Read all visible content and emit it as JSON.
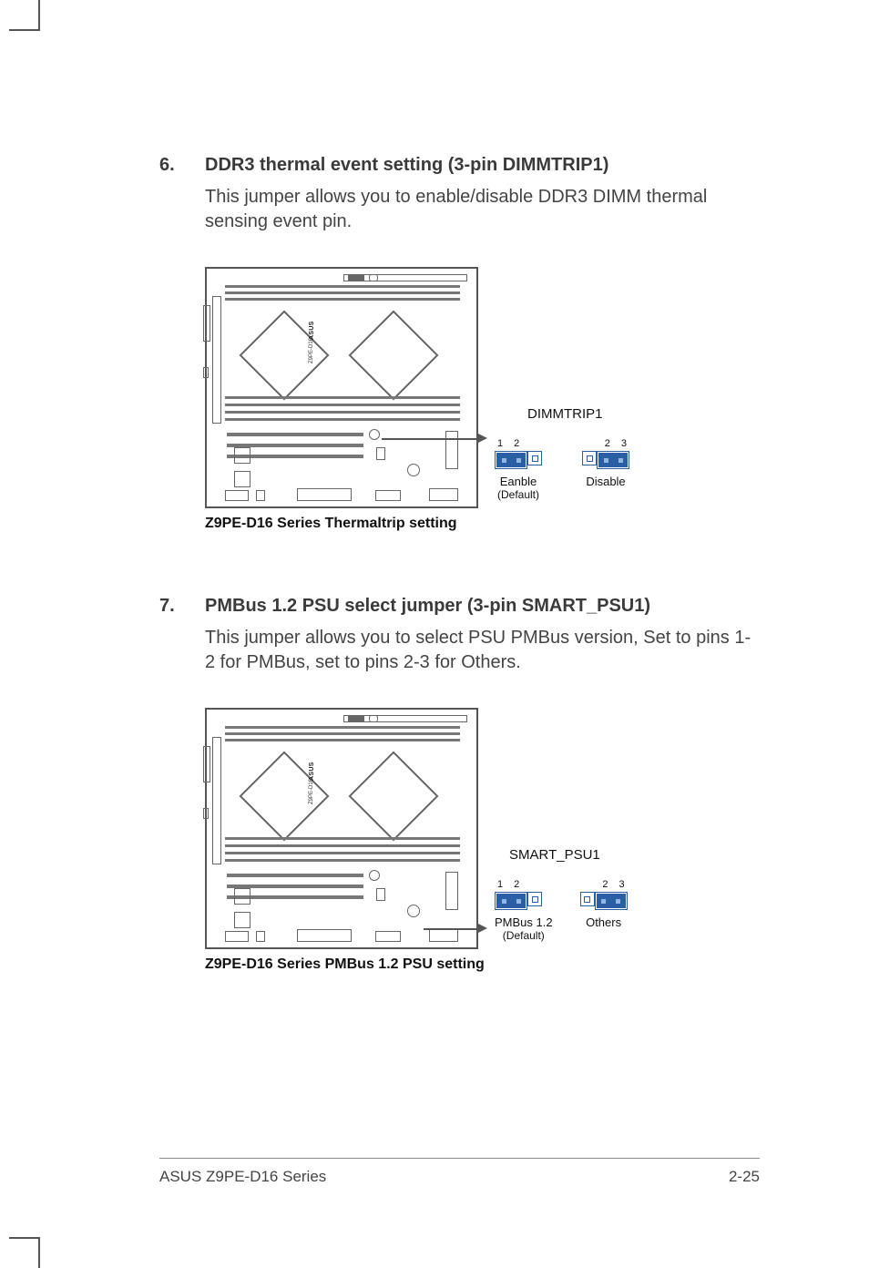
{
  "items": [
    {
      "num": "6.",
      "title": "DDR3 thermal event setting (3-pin DIMMTRIP1)",
      "body": "This jumper allows you to enable/disable DDR3 DIMM thermal sensing event pin.",
      "jumper_name": "DIMMTRIP1",
      "opt1": {
        "pins_label_a": "1",
        "pins_label_b": "2",
        "label": "Eanble",
        "sub": "(Default)"
      },
      "opt2": {
        "pins_label_a": "2",
        "pins_label_b": "3",
        "label": "Disable",
        "sub": ""
      },
      "caption": "Z9PE-D16 Series Thermaltrip setting",
      "board_brand": "ASUS",
      "board_model": "Z9PE-D16"
    },
    {
      "num": "7.",
      "title": "PMBus 1.2 PSU select jumper (3-pin SMART_PSU1)",
      "body": "This jumper allows you to select PSU PMBus version,  Set to pins 1-2 for PMBus, set to pins 2-3 for Others.",
      "jumper_name": "SMART_PSU1",
      "opt1": {
        "pins_label_a": "1",
        "pins_label_b": "2",
        "label": "PMBus 1.2",
        "sub": "(Default)"
      },
      "opt2": {
        "pins_label_a": "2",
        "pins_label_b": "3",
        "label": "Others",
        "sub": ""
      },
      "caption": "Z9PE-D16 Series PMBus 1.2 PSU setting",
      "board_brand": "ASUS",
      "board_model": "Z9PE-D16"
    }
  ],
  "footer": {
    "left": "ASUS Z9PE-D16 Series",
    "right": "2-25"
  }
}
